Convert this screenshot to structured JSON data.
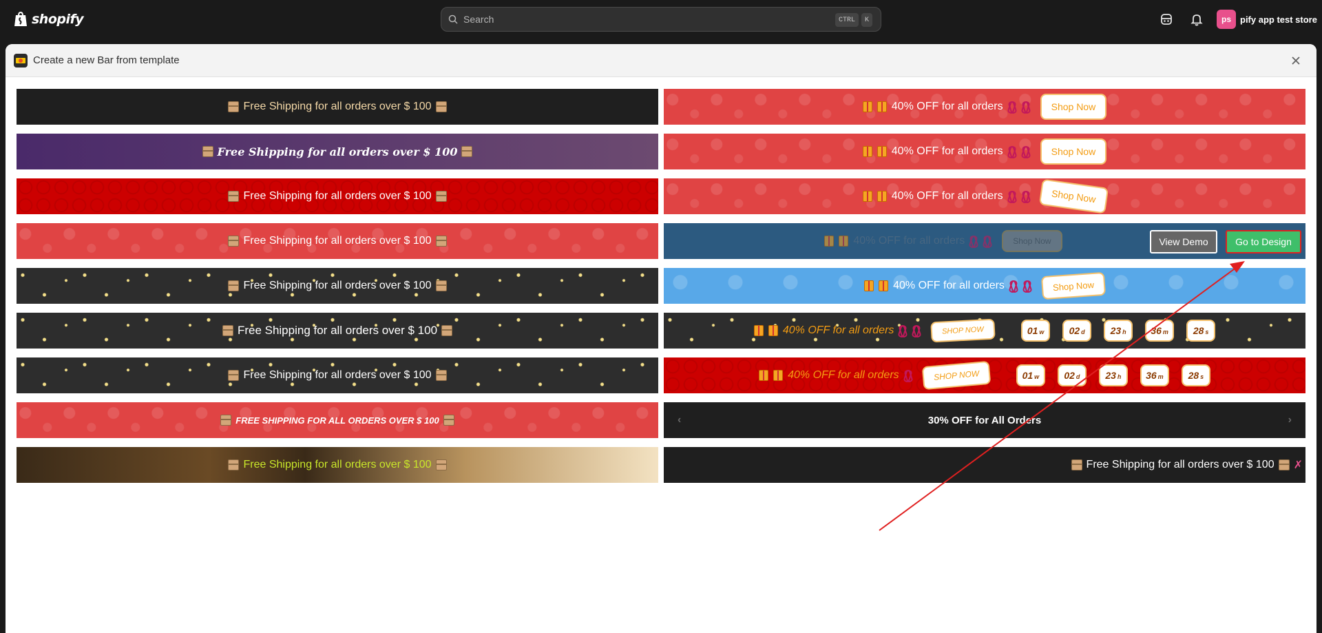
{
  "topbar": {
    "logo_text": "shopify",
    "search_placeholder": "Search",
    "search_shortcut_1": "CTRL",
    "search_shortcut_2": "K",
    "store_avatar": "ps",
    "store_name": "pify app test store"
  },
  "modal": {
    "title": "Create a new Bar from template"
  },
  "templates": {
    "left": [
      "Free Shipping for all orders over $ 100",
      "Free Shipping for all orders over $ 100",
      "Free Shipping for all orders over $ 100",
      "Free Shipping for all orders over $ 100",
      "Free Shipping for all orders over $ 100",
      "Free Shipping for all orders over $ 100",
      "Free Shipping for all orders over $ 100",
      "FREE SHIPPING FOR ALL ORDERS OVER $ 100",
      "Free Shipping for all orders over $ 100"
    ],
    "right": {
      "offer": "40% OFF for all orders",
      "shop_now": "Shop Now",
      "shop_now_upper": "SHOP NOW",
      "countdown": [
        {
          "value": "01",
          "unit": "w"
        },
        {
          "value": "02",
          "unit": "d"
        },
        {
          "value": "23",
          "unit": "h"
        },
        {
          "value": "36",
          "unit": "m"
        },
        {
          "value": "28",
          "unit": "s"
        }
      ],
      "slider_text": "30% OFF for All Orders",
      "marquee_text": "Free Shipping for all orders over $ 100"
    }
  },
  "hover_actions": {
    "view_demo": "View Demo",
    "go_to_design": "Go to Design"
  },
  "colors": {
    "accent_green": "#3fbf6a",
    "annotation_red": "#e02020"
  }
}
